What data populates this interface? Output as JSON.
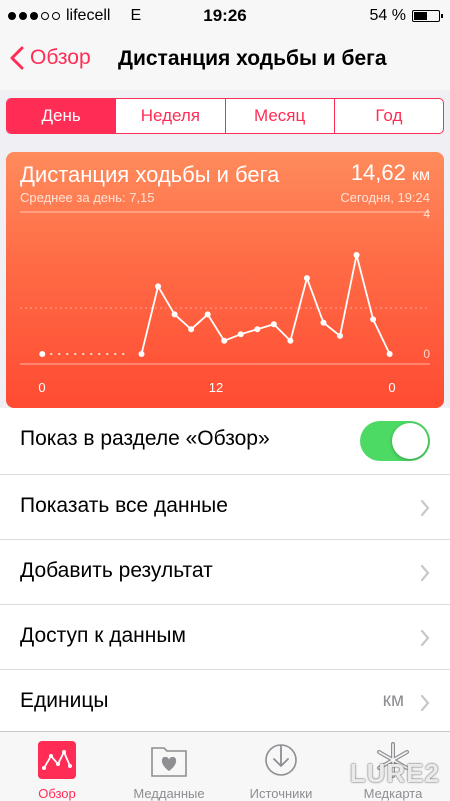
{
  "status": {
    "carrier": "lifecell",
    "network": "E",
    "time": "19:26",
    "battery": "54 %",
    "battery_level": 0.54,
    "signal_bars": 3
  },
  "nav": {
    "back_label": "Обзор",
    "title": "Дистанция ходьбы и бега"
  },
  "segments": [
    {
      "label": "День",
      "active": true
    },
    {
      "label": "Неделя",
      "active": false
    },
    {
      "label": "Месяц",
      "active": false
    },
    {
      "label": "Год",
      "active": false
    }
  ],
  "chart_card": {
    "title": "Дистанция ходьбы и бега",
    "value": "14,62",
    "unit": "км",
    "average": "Среднее за день: 7,15",
    "date": "Сегодня, 19:24"
  },
  "chart_data": {
    "type": "line",
    "x_labels": [
      "0",
      "12",
      "0"
    ],
    "y_labels": [
      "4",
      "0"
    ],
    "ylim": [
      0,
      4
    ],
    "xlim": [
      0,
      24
    ],
    "grid": true,
    "points": [
      {
        "x": 0.5,
        "y": 0.0
      },
      {
        "x": 1.5,
        "y": 0.0
      },
      {
        "x": 2.5,
        "y": 0.0
      },
      {
        "x": 3.5,
        "y": 0.0
      },
      {
        "x": 4.5,
        "y": 0.0
      },
      {
        "x": 5.5,
        "y": 0.0
      },
      {
        "x": 6.5,
        "y": 0.0
      },
      {
        "x": 7.5,
        "y": 2.05
      },
      {
        "x": 8.5,
        "y": 1.2
      },
      {
        "x": 9.5,
        "y": 0.75
      },
      {
        "x": 10.5,
        "y": 1.2
      },
      {
        "x": 11.5,
        "y": 0.4
      },
      {
        "x": 12.5,
        "y": 0.6
      },
      {
        "x": 13.5,
        "y": 0.75
      },
      {
        "x": 14.5,
        "y": 0.9
      },
      {
        "x": 15.5,
        "y": 0.4
      },
      {
        "x": 16.5,
        "y": 2.3
      },
      {
        "x": 17.5,
        "y": 0.95
      },
      {
        "x": 18.5,
        "y": 0.55
      },
      {
        "x": 19.5,
        "y": 3.0
      },
      {
        "x": 20.5,
        "y": 1.05
      },
      {
        "x": 21.5,
        "y": 0.0
      }
    ],
    "color": "#ffffff"
  },
  "list": {
    "show_in_overview": {
      "label": "Показ в разделе «Обзор»",
      "on": true
    },
    "show_all_data": {
      "label": "Показать все данные"
    },
    "add_result": {
      "label": "Добавить результат"
    },
    "data_access": {
      "label": "Доступ к данным"
    },
    "units": {
      "label": "Единицы",
      "value": "км"
    }
  },
  "tabs": [
    {
      "label": "Обзор",
      "active": true,
      "icon": "overview-icon"
    },
    {
      "label": "Медданные",
      "active": false,
      "icon": "health-data-icon"
    },
    {
      "label": "Источники",
      "active": false,
      "icon": "sources-icon"
    },
    {
      "label": "Медкарта",
      "active": false,
      "icon": "medical-id-icon"
    }
  ],
  "watermark": "LURE2",
  "colors": {
    "accent": "#ff2d55",
    "toggle_on": "#4cd964",
    "chart_top": "#ff8b5c",
    "chart_bottom": "#ff4b32"
  }
}
